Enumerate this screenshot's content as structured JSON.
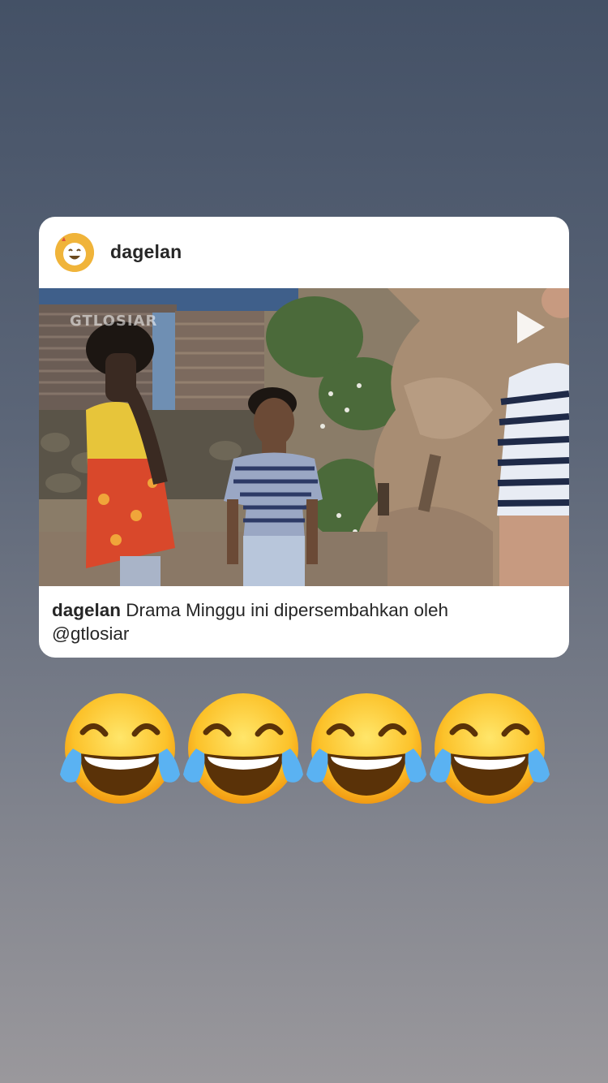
{
  "post": {
    "username": "dagelan",
    "caption_user": "dagelan",
    "caption_text": "Drama Minggu ini dipersembahkan oleh",
    "caption_mention": "@gtlosiar",
    "video_watermark": "GTLOSIAR"
  },
  "icons": {
    "avatar": "laughing-face-avatar-icon",
    "play": "play-icon",
    "sticker": "face-with-tears-of-joy-icon"
  },
  "sticker_count": 4,
  "colors": {
    "card_background": "#ffffff",
    "text": "#262626",
    "avatar_yellow": "#f0b43a"
  }
}
